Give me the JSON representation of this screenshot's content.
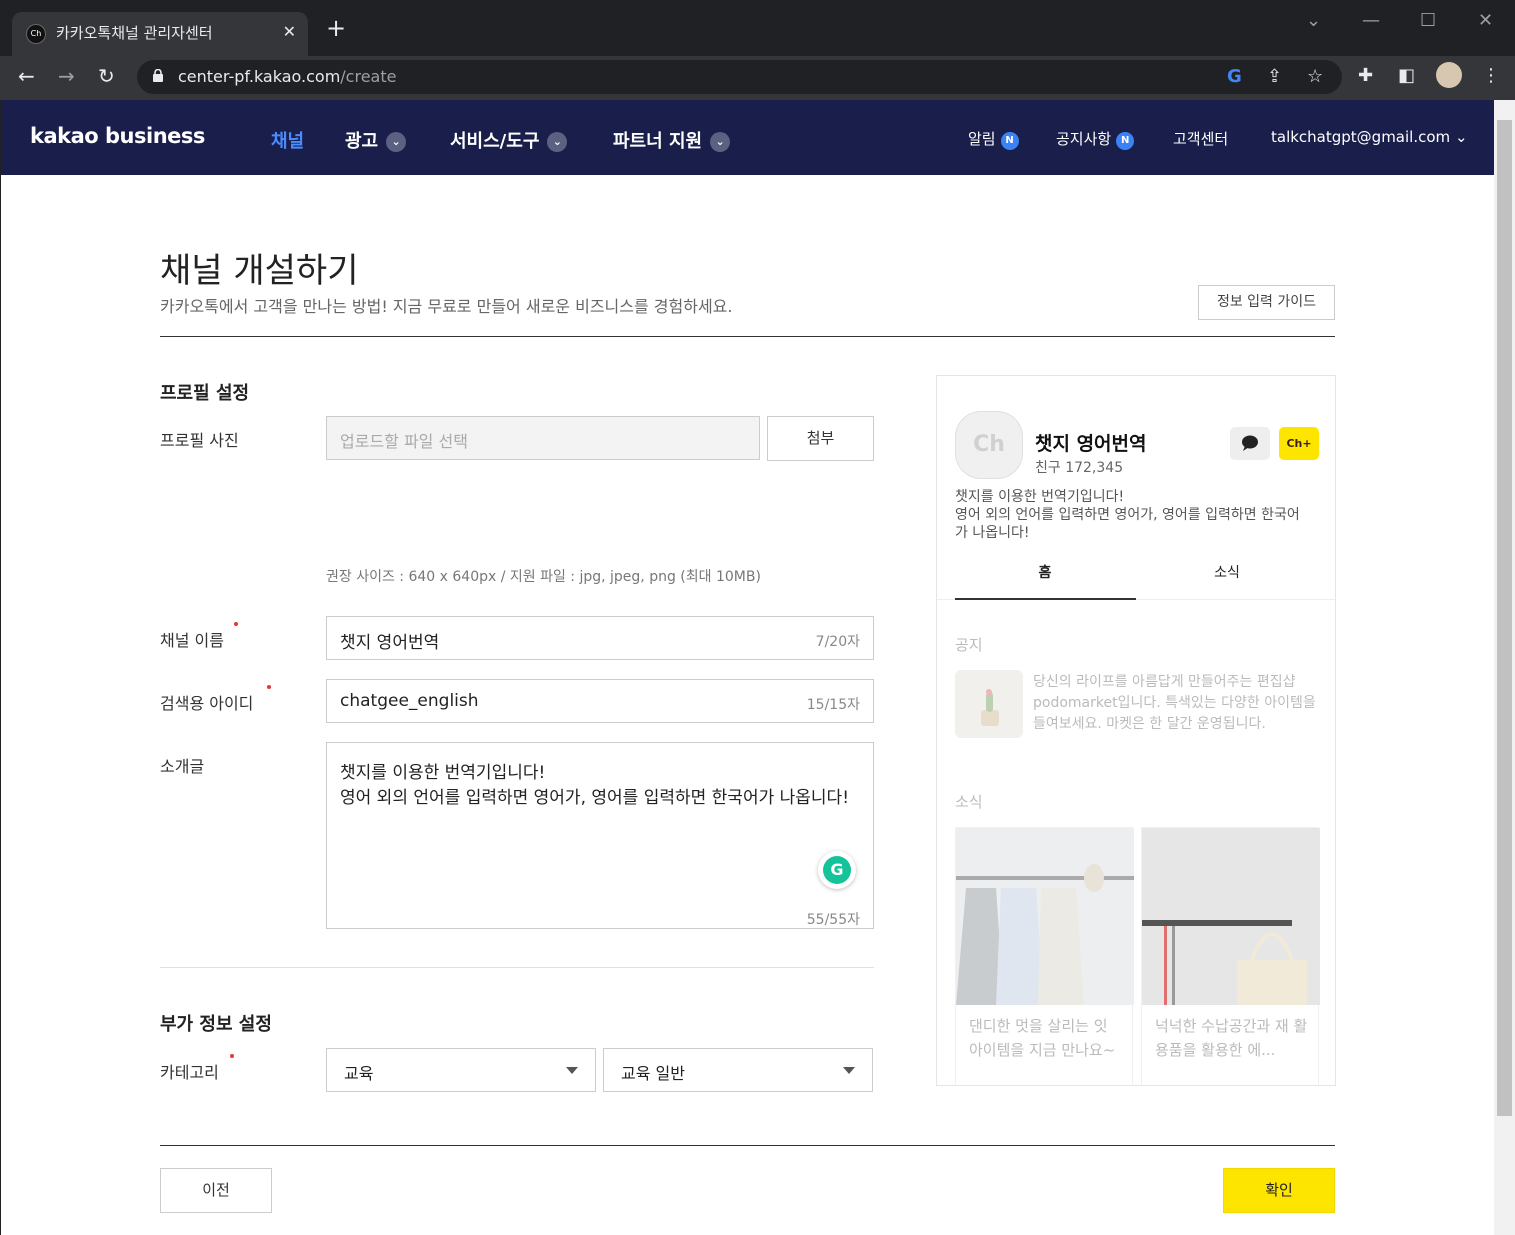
{
  "browser": {
    "tab_title": "카카오톡채널 관리자센터",
    "favicon_text": "Ch",
    "url_host": "center-pf.kakao.com",
    "url_path": "/create"
  },
  "gnb": {
    "logo": "kakao business",
    "menus": [
      {
        "label": "채널"
      },
      {
        "label": "광고"
      },
      {
        "label": "서비스/도구"
      },
      {
        "label": "파트너 지원"
      }
    ],
    "alarm": "알림",
    "notice": "공지사항",
    "badge": "N",
    "support": "고객센터",
    "account": "talkchatgpt@gmail.com"
  },
  "page": {
    "title": "채널 개설하기",
    "subtitle": "카카오톡에서 고객을 만나는 방법! 지금 무료로 만들어 새로운 비즈니스를 경험하세요.",
    "guide_button": "정보 입력 가이드"
  },
  "profile": {
    "section_title": "프로필 설정",
    "photo_label": "프로필 사진",
    "photo_placeholder": "업로드할 파일 선택",
    "attach_button": "첨부",
    "photo_hint": "권장 사이즈 : 640 x 640px / 지원 파일 : jpg, jpeg, png (최대 10MB)",
    "name_label": "채널 이름",
    "name_value": "챗지 영어번역",
    "name_counter": "7/20자",
    "id_label": "검색용 아이디",
    "id_value": "chatgee_english",
    "id_counter": "15/15자",
    "intro_label": "소개글",
    "intro_line1": "챗지를 이용한 번역기입니다!",
    "intro_line2": "영어 외의 언어를 입력하면 영어가, 영어를 입력하면 한국어가 나옵니다!",
    "intro_counter": "55/55자"
  },
  "extra": {
    "section_title": "부가 정보 설정",
    "category_label": "카테고리",
    "category_main": "교육",
    "category_sub": "교육 일반"
  },
  "preview": {
    "avatar_text": "Ch",
    "name": "챗지 영어번역",
    "friends": "친구 172,345",
    "plus_label": "Ch+",
    "desc_line1": "챗지를 이용한 번역기입니다!",
    "desc_line2": "영어 외의 언어를 입력하면 영어가, 영어를 입력하면 한국어",
    "desc_line3": "가 나옵니다!",
    "tab_home": "홈",
    "tab_news": "소식",
    "notice_title": "공지",
    "notice_text": "당신의 라이프를 아름답게 만들어주는 편집샵 podomarket입니다. 특색있는 다양한 아이템을 들여보세요. 마켓은 한 달간 운영됩니다.",
    "news_title": "소식",
    "card1_text": "댄디한 멋을 살리는 잇 아이템을 지금 만나요~",
    "card2_text": "넉넉한 수납공간과 재 활용품을 활용한 에..."
  },
  "footer": {
    "prev_button": "이전",
    "ok_button": "확인"
  }
}
